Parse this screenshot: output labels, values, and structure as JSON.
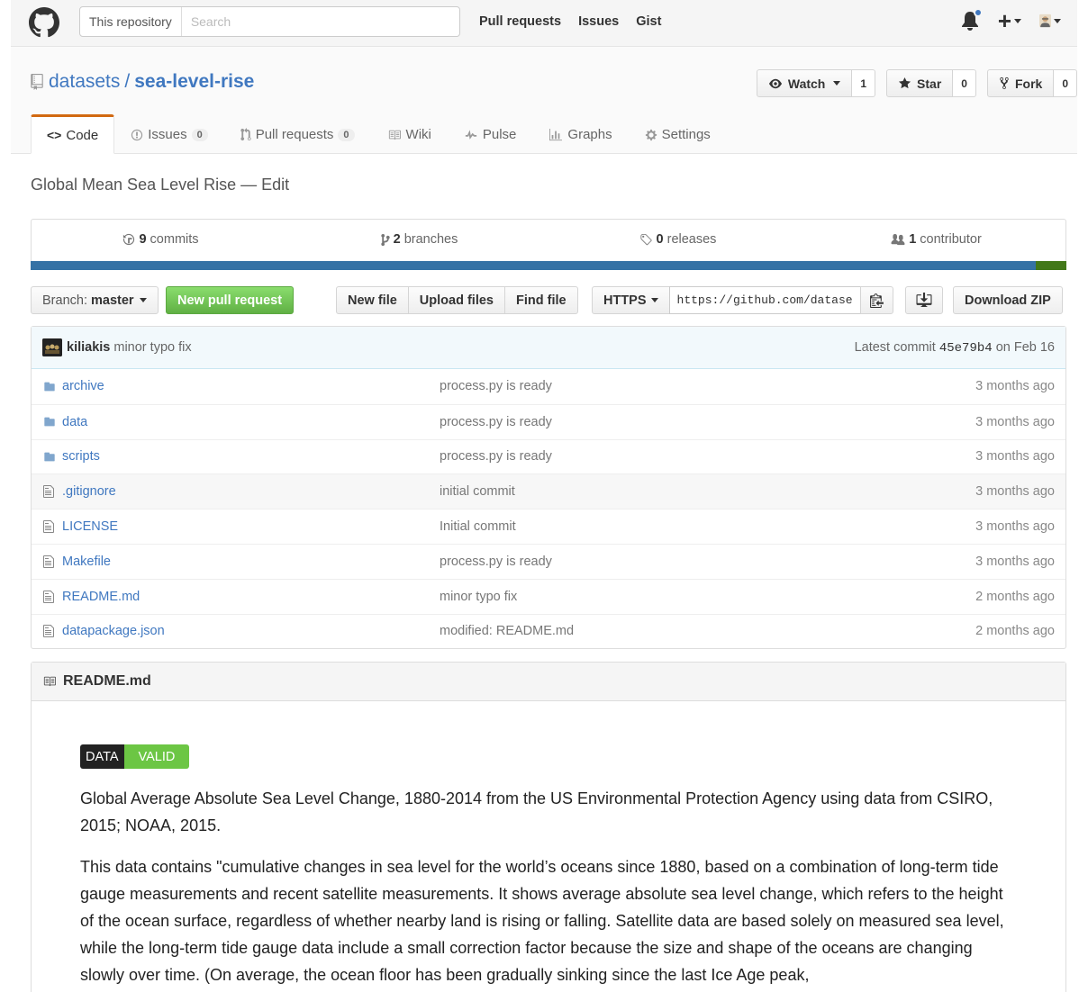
{
  "header": {
    "search_scope": "This repository",
    "search_placeholder": "Search",
    "nav": [
      "Pull requests",
      "Issues",
      "Gist"
    ]
  },
  "repo": {
    "owner": "datasets",
    "name": "sea-level-rise",
    "watch_label": "Watch",
    "watch_count": "1",
    "star_label": "Star",
    "star_count": "0",
    "fork_label": "Fork",
    "fork_count": "0"
  },
  "tabs": [
    {
      "label": "Code",
      "icon": "code-icon"
    },
    {
      "label": "Issues",
      "count": "0",
      "icon": "issue-icon"
    },
    {
      "label": "Pull requests",
      "count": "0",
      "icon": "pull-request-icon"
    },
    {
      "label": "Wiki",
      "icon": "book-icon"
    },
    {
      "label": "Pulse",
      "icon": "pulse-icon"
    },
    {
      "label": "Graphs",
      "icon": "graph-icon"
    },
    {
      "label": "Settings",
      "icon": "gear-icon"
    }
  ],
  "description": "Global Mean Sea Level Rise — Edit",
  "summary": {
    "commits_num": "9",
    "commits_label": "commits",
    "branches_num": "2",
    "branches_label": "branches",
    "releases_num": "0",
    "releases_label": "releases",
    "contributors_num": "1",
    "contributors_label": "contributor"
  },
  "file_nav": {
    "branch_prefix": "Branch:",
    "branch": "master",
    "new_pr": "New pull request",
    "new_file": "New file",
    "upload_files": "Upload files",
    "find_file": "Find file",
    "protocol": "HTTPS",
    "clone_url": "https://github.com/datasets/sea-level-rise.git",
    "download_zip": "Download ZIP"
  },
  "latest_commit": {
    "author": "kiliakis",
    "message": "minor typo fix",
    "prefix": "Latest commit",
    "sha": "45e79b4",
    "date": "on Feb 16"
  },
  "files": [
    {
      "type": "dir",
      "name": "archive",
      "message": "process.py is ready",
      "age": "3 months ago"
    },
    {
      "type": "dir",
      "name": "data",
      "message": "process.py is ready",
      "age": "3 months ago"
    },
    {
      "type": "dir",
      "name": "scripts",
      "message": "process.py is ready",
      "age": "3 months ago"
    },
    {
      "type": "file",
      "name": ".gitignore",
      "message": "initial commit",
      "age": "3 months ago"
    },
    {
      "type": "file",
      "name": "LICENSE",
      "message": "Initial commit",
      "age": "3 months ago"
    },
    {
      "type": "file",
      "name": "Makefile",
      "message": "process.py is ready",
      "age": "3 months ago"
    },
    {
      "type": "file",
      "name": "README.md",
      "message": "minor typo fix",
      "age": "2 months ago"
    },
    {
      "type": "file",
      "name": "datapackage.json",
      "message": "modified: README.md",
      "age": "2 months ago"
    }
  ],
  "readme": {
    "title": "README.md",
    "badge_left": "DATA",
    "badge_right": "VALID",
    "para1": "Global Average Absolute Sea Level Change, 1880-2014 from the US Environmental Protection Agency using data from CSIRO, 2015; NOAA, 2015.",
    "para2": "This data contains \"cumulative changes in sea level for the world’s oceans since 1880, based on a combination of long-term tide gauge measurements and recent satellite measurements. It shows average absolute sea level change, which refers to the height of the ocean surface, regardless of whether nearby land is rising or falling. Satellite data are based solely on measured sea level, while the long-term tide gauge data include a small correction factor because the size and shape of the oceans are changing slowly over time. (On average, the ocean floor has been gradually sinking since the last Ice Age peak,"
  },
  "colors": {
    "link": "#4078c0",
    "tab_accent": "#d26911",
    "python": "#3572a5",
    "makefile": "#427819",
    "new_pr_green": "#6cc644"
  }
}
